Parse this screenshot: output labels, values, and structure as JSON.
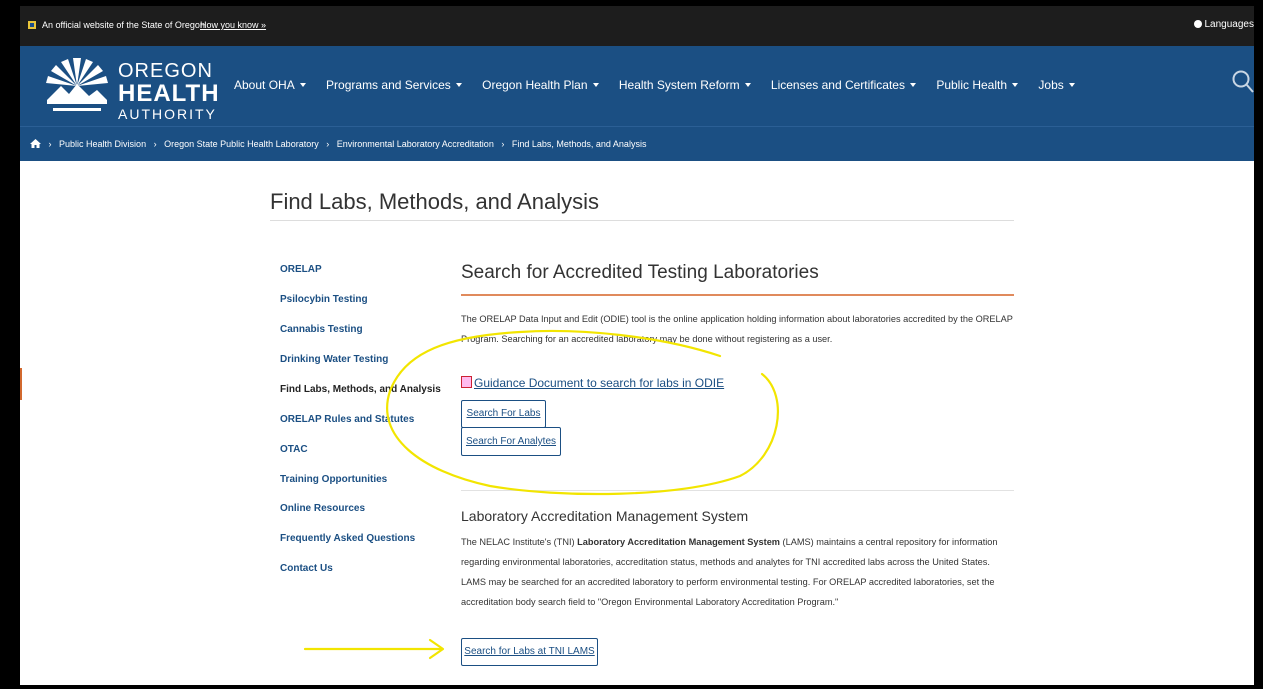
{
  "gov_bar": {
    "official_text": "An official website of the State of Oregon",
    "how_you_know": "How you know »",
    "languages": "Languages"
  },
  "logo": {
    "line1": "OREGON",
    "line2": "HEALTH",
    "line3": "AUTHORITY"
  },
  "nav": [
    "About OHA",
    "Programs and Services",
    "Oregon Health Plan",
    "Health System Reform",
    "Licenses and Certificates",
    "Public Health",
    "Jobs"
  ],
  "breadcrumb": [
    "Public Health Division",
    "Oregon State Public Health Laboratory",
    "Environmental Laboratory Accreditation",
    "Find Labs, Methods, and Analysis"
  ],
  "page_title": "Find Labs, Methods, and Analysis",
  "sidebar": [
    "ORELAP",
    "Psilocybin Testing",
    "Cannabis Testing",
    "Drinking Water Testing",
    "Find Labs, Methods, and Analysis",
    "ORELAP Rules and Statutes",
    "OTAC",
    "Training Opportunities",
    "Online Resources",
    "Frequently Asked Questions",
    "Contact Us"
  ],
  "section1": {
    "heading": "Search for Accredited Testing Laboratories",
    "para_line1": "The ORELAP Data Input and Edit (ODIE) tool is the online application holding information about laboratories accredited by the ORELAP",
    "para_line2": "Program.  Searching for an accredited laboratory may be done without registering as a user.",
    "guide_link": "Guidance Document to search for labs in ODIE",
    "btn_labs": "Search For Labs",
    "btn_analytes": "Search For Analytes"
  },
  "section2": {
    "heading": "Laboratory Accreditation Management System",
    "para_a": "The NELAC Institute's (TNI) ",
    "para_bold": "Laboratory Accreditation Management System",
    "para_b": " (LAMS) maintains a central repository for information",
    "line2": "regarding environmental laboratories, accreditation status, methods and analytes for TNI accredited labs across the United States.",
    "line3": "LAMS may be searched for an accredited laboratory to perform environmental testing.  For ORELAP accredited laboratories, set the",
    "line4": "accreditation body search field to \"Oregon Environmental Laboratory Accreditation Program.\"",
    "btn_lams": "Search for Labs at TNI LAMS"
  },
  "colors": {
    "brand_blue": "#1b4f83",
    "gov_bar": "#1d1d1d",
    "accent_orange": "#e08a5c",
    "annotation_yellow": "#f2e500"
  }
}
